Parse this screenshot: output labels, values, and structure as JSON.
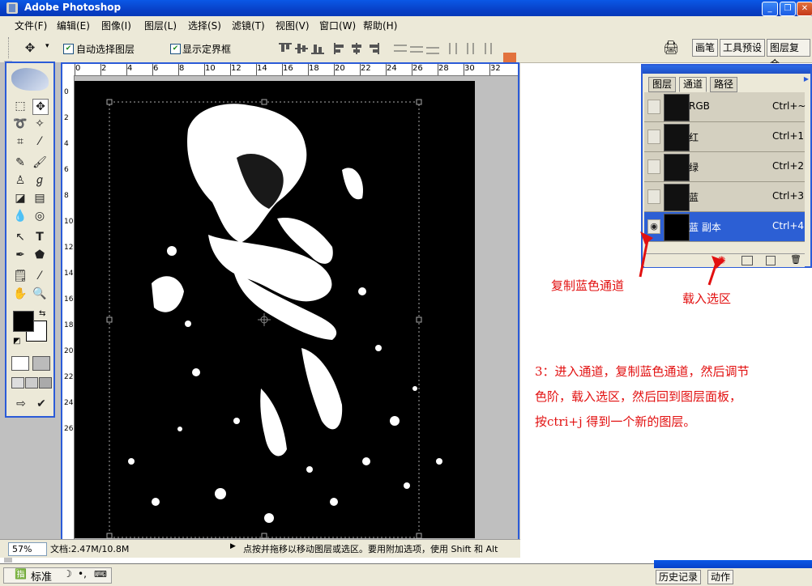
{
  "app": {
    "title": "Adobe Photoshop",
    "window_buttons": {
      "minimize": "_",
      "restore": "❐",
      "close": "✕"
    }
  },
  "menu": [
    {
      "label": "文件(F)"
    },
    {
      "label": "编辑(E)"
    },
    {
      "label": "图像(I)"
    },
    {
      "label": "图层(L)"
    },
    {
      "label": "选择(S)"
    },
    {
      "label": "滤镜(T)"
    },
    {
      "label": "视图(V)"
    },
    {
      "label": "窗口(W)"
    },
    {
      "label": "帮助(H)"
    }
  ],
  "options": {
    "tool_icon": "move-tool-icon",
    "auto_select_label": "自动选择图层",
    "auto_select_checked": true,
    "show_bounds_label": "显示定界框",
    "show_bounds_checked": true
  },
  "palette_well": {
    "tabs": [
      "画笔",
      "工具预设",
      "图层复合"
    ]
  },
  "ruler": {
    "top_numbers": [
      "0",
      "2",
      "4",
      "6",
      "8",
      "10",
      "12",
      "14",
      "16",
      "18",
      "20",
      "22",
      "24",
      "26",
      "28",
      "30",
      "32"
    ],
    "left_numbers": [
      "0",
      "2",
      "4",
      "6",
      "8",
      "10",
      "12",
      "14",
      "16",
      "18",
      "20",
      "22",
      "24",
      "26"
    ]
  },
  "status": {
    "zoom": "57%",
    "doc": "文档:2.47M/10.8M",
    "hint": "点按并拖移以移动图层或选区。要用附加选项，使用 Shift 和 Alt"
  },
  "panel": {
    "tabs": [
      "图层",
      "通道",
      "路径"
    ],
    "active_tab": 1,
    "channels": [
      {
        "name": "RGB",
        "shortcut": "Ctrl+~",
        "visible": false,
        "selected": false
      },
      {
        "name": "红",
        "shortcut": "Ctrl+1",
        "visible": false,
        "selected": false
      },
      {
        "name": "绿",
        "shortcut": "Ctrl+2",
        "visible": false,
        "selected": false
      },
      {
        "name": "蓝",
        "shortcut": "Ctrl+3",
        "visible": false,
        "selected": false
      },
      {
        "name": "蓝 副本",
        "shortcut": "Ctrl+4",
        "visible": true,
        "selected": true
      }
    ]
  },
  "annotations": {
    "copy_blue": "复制蓝色通道",
    "load_selection": "载入选区",
    "step_text_line1": "3：进入通道，复制蓝色通道，然后调节",
    "step_text_line2": "色阶，载入选区，然后回到图层面板，",
    "step_text_line3": "按ctri+j 得到一个新的图层。"
  },
  "bottom": {
    "ime_label": "标准",
    "tabs": [
      "历史记录",
      "动作"
    ]
  },
  "colors": {
    "accent": "#2b5bd8",
    "annotation": "#e21010",
    "selected_row": "#2c5fd4"
  }
}
